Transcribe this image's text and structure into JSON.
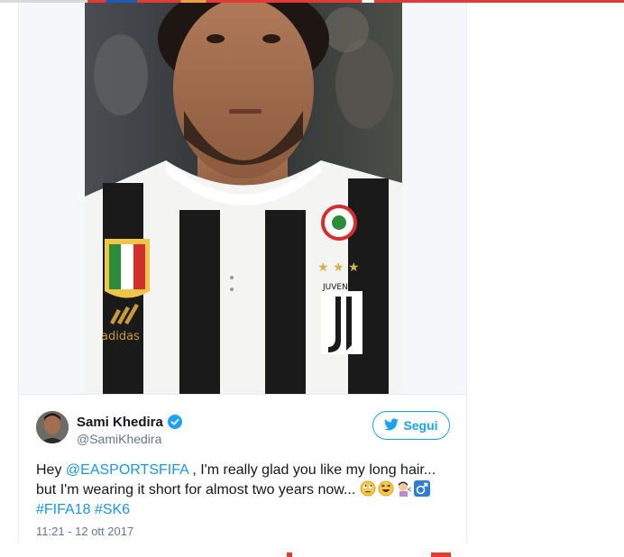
{
  "tweet": {
    "author": {
      "display_name": "Sami Khedira",
      "handle": "@SamiKhedira",
      "verified": true
    },
    "follow_button": {
      "label": "Segui",
      "icon": "twitter-bird-icon"
    },
    "text": {
      "prefix": "Hey ",
      "mention": "@EASPORTSFIFA",
      "line1_rest": " , I'm really glad you like my long hair...",
      "line2": "but I'm wearing it short for almost two years now... ",
      "emojis": [
        "rolling-eyes-emoji",
        "grinning-squinting-emoji",
        "woman-haircut-emoji",
        "male-sign-emoji"
      ],
      "hashtag1": "#FIFA18",
      "hashtag2": "#SK6"
    },
    "timestamp": "11:21 - 12 ott 2017"
  },
  "colors": {
    "link": "#1b95e0",
    "twitter_blue": "#1da1f2",
    "text": "#14171a",
    "muted": "#657786",
    "embed_bg": "#f5f8fa"
  }
}
